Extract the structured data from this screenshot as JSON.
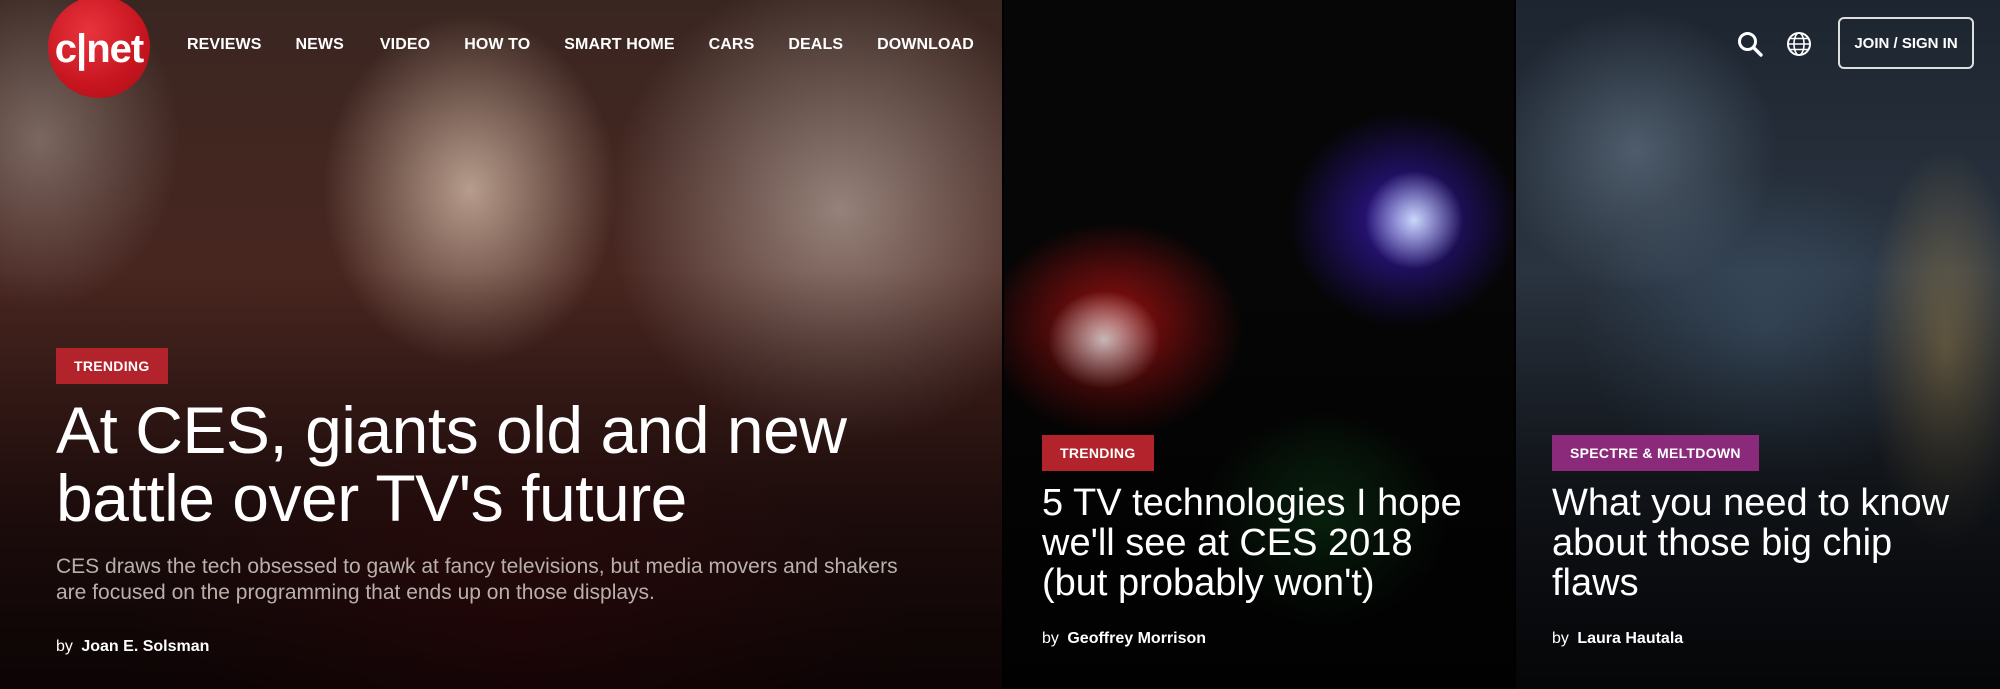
{
  "brand": {
    "logo_text": "c|net",
    "accent": "#c7151f"
  },
  "nav": {
    "items": [
      "REVIEWS",
      "NEWS",
      "VIDEO",
      "HOW TO",
      "SMART HOME",
      "CARS",
      "DEALS",
      "DOWNLOAD"
    ]
  },
  "header": {
    "search_icon": "search-icon",
    "region_icon": "globe-icon",
    "join_label": "JOIN / SIGN IN"
  },
  "stories": [
    {
      "tag": "TRENDING",
      "tag_color": "#b3232b",
      "headline": "At CES, giants old and new battle over TV's future",
      "dek": "CES draws the tech obsessed to gawk at fancy televisions, but media movers and shakers are focused on the programming that ends up on those displays.",
      "by": "by",
      "author": "Joan E. Solsman"
    },
    {
      "tag": "TRENDING",
      "tag_color": "#b3232b",
      "headline": "5 TV technologies I hope we'll see at CES 2018 (but probably won't)",
      "by": "by",
      "author": "Geoffrey Morrison"
    },
    {
      "tag": "SPECTRE & MELTDOWN",
      "tag_color": "#8b2a7a",
      "headline": "What you need to know about those big chip flaws",
      "by": "by",
      "author": "Laura Hautala"
    }
  ]
}
